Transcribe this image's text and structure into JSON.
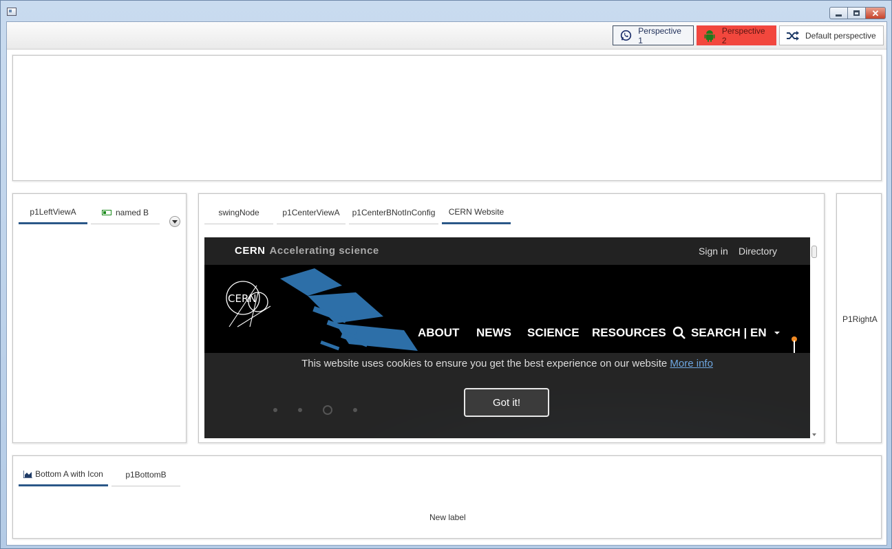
{
  "toolbar": {
    "perspective_1": "Perspective 1",
    "perspective_2": "Perspective 2",
    "default_perspective": "Default perspective"
  },
  "left_panel": {
    "tabs": [
      {
        "label": "p1LeftViewA",
        "active": true
      },
      {
        "label": "named B",
        "active": false
      }
    ]
  },
  "center_panel": {
    "tabs": [
      {
        "label": "swingNode",
        "active": false
      },
      {
        "label": "p1CenterViewA",
        "active": false
      },
      {
        "label": "p1CenterBNotInConfig",
        "active": false
      },
      {
        "label": "CERN Website",
        "active": true
      }
    ]
  },
  "cern_site": {
    "brand": "CERN",
    "slogan": "Accelerating science",
    "sign_in": "Sign in",
    "directory": "Directory",
    "nav": [
      "ABOUT",
      "NEWS",
      "SCIENCE",
      "RESOURCES"
    ],
    "search": "SEARCH |",
    "lang": "EN",
    "logo_text": "CERN",
    "cookie_text": "This website uses cookies to ensure you get the best experience on our website",
    "cookie_link": "More info",
    "got_it": "Got it!"
  },
  "right_panel": {
    "label": "P1RightA"
  },
  "bottom_panel": {
    "tabs": [
      {
        "label": "Bottom A with Icon",
        "active": true
      },
      {
        "label": "p1BottomB",
        "active": false
      }
    ],
    "content_label": "New label"
  },
  "colors": {
    "accent": "#2a5788",
    "perspective_2_bg": "#f2473d"
  }
}
